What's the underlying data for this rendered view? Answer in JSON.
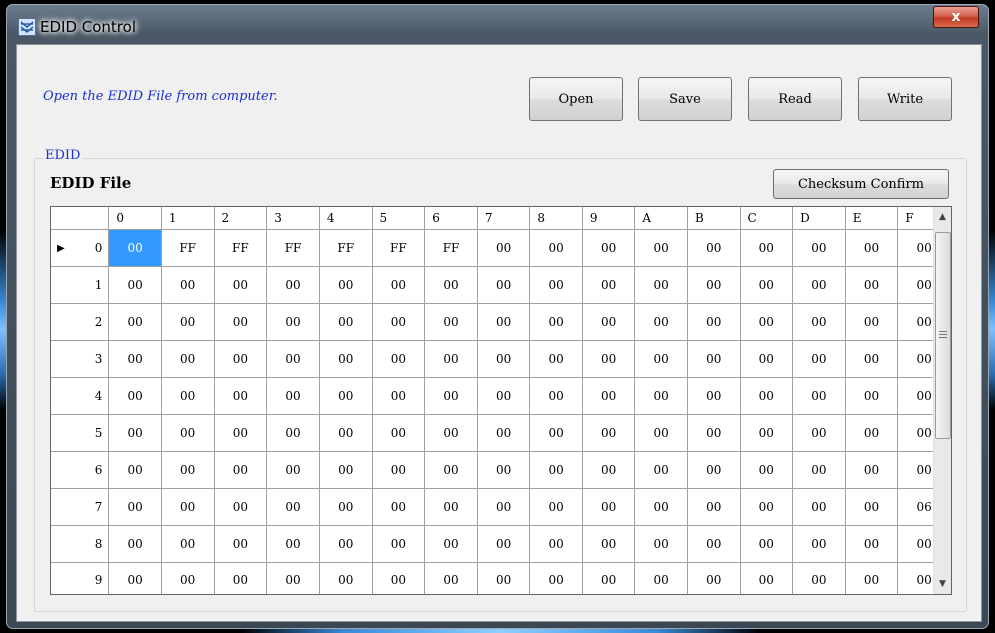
{
  "window": {
    "title": "EDID Control",
    "close_label": "x"
  },
  "hint": "Open the EDID File from computer.",
  "toolbar": {
    "open": "Open",
    "save": "Save",
    "read": "Read",
    "write": "Write"
  },
  "group": {
    "legend": "EDID",
    "file_label": "EDID File",
    "checksum": "Checksum Confirm"
  },
  "grid": {
    "columns": [
      "0",
      "1",
      "2",
      "3",
      "4",
      "5",
      "6",
      "7",
      "8",
      "9",
      "A",
      "B",
      "C",
      "D",
      "E",
      "F"
    ],
    "rows": [
      {
        "label": "0",
        "cells": [
          "00",
          "FF",
          "FF",
          "FF",
          "FF",
          "FF",
          "FF",
          "00",
          "00",
          "00",
          "00",
          "00",
          "00",
          "00",
          "00",
          "00"
        ]
      },
      {
        "label": "1",
        "cells": [
          "00",
          "00",
          "00",
          "00",
          "00",
          "00",
          "00",
          "00",
          "00",
          "00",
          "00",
          "00",
          "00",
          "00",
          "00",
          "00"
        ]
      },
      {
        "label": "2",
        "cells": [
          "00",
          "00",
          "00",
          "00",
          "00",
          "00",
          "00",
          "00",
          "00",
          "00",
          "00",
          "00",
          "00",
          "00",
          "00",
          "00"
        ]
      },
      {
        "label": "3",
        "cells": [
          "00",
          "00",
          "00",
          "00",
          "00",
          "00",
          "00",
          "00",
          "00",
          "00",
          "00",
          "00",
          "00",
          "00",
          "00",
          "00"
        ]
      },
      {
        "label": "4",
        "cells": [
          "00",
          "00",
          "00",
          "00",
          "00",
          "00",
          "00",
          "00",
          "00",
          "00",
          "00",
          "00",
          "00",
          "00",
          "00",
          "00"
        ]
      },
      {
        "label": "5",
        "cells": [
          "00",
          "00",
          "00",
          "00",
          "00",
          "00",
          "00",
          "00",
          "00",
          "00",
          "00",
          "00",
          "00",
          "00",
          "00",
          "00"
        ]
      },
      {
        "label": "6",
        "cells": [
          "00",
          "00",
          "00",
          "00",
          "00",
          "00",
          "00",
          "00",
          "00",
          "00",
          "00",
          "00",
          "00",
          "00",
          "00",
          "00"
        ]
      },
      {
        "label": "7",
        "cells": [
          "00",
          "00",
          "00",
          "00",
          "00",
          "00",
          "00",
          "00",
          "00",
          "00",
          "00",
          "00",
          "00",
          "00",
          "00",
          "06"
        ]
      },
      {
        "label": "8",
        "cells": [
          "00",
          "00",
          "00",
          "00",
          "00",
          "00",
          "00",
          "00",
          "00",
          "00",
          "00",
          "00",
          "00",
          "00",
          "00",
          "00"
        ]
      },
      {
        "label": "9",
        "cells": [
          "00",
          "00",
          "00",
          "00",
          "00",
          "00",
          "00",
          "00",
          "00",
          "00",
          "00",
          "00",
          "00",
          "00",
          "00",
          "00"
        ]
      }
    ],
    "selected_row": 0,
    "selected_col": 0
  },
  "colors": {
    "accent_text": "#1a2fd6",
    "selection": "#3399ff"
  }
}
